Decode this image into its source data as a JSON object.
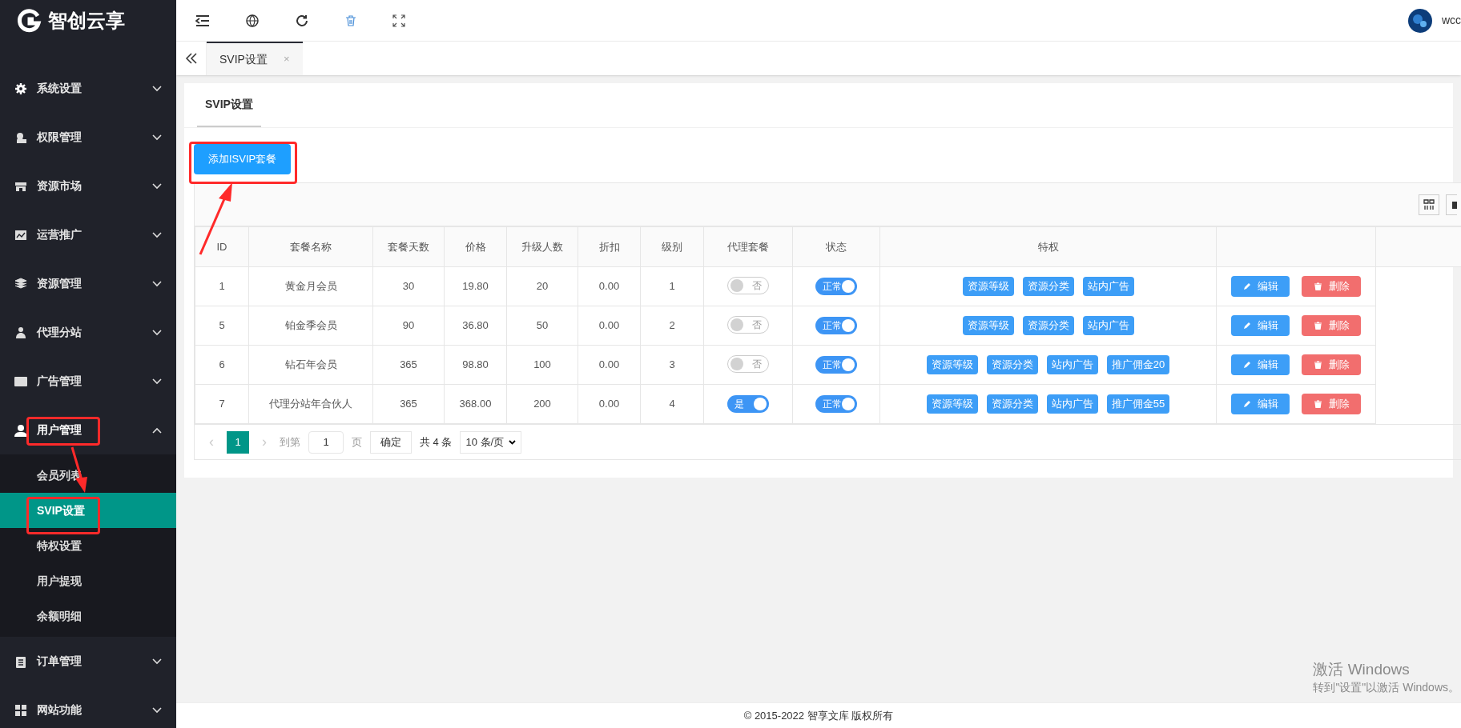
{
  "logo": {
    "text": "智创云享"
  },
  "sidebar": {
    "items": [
      {
        "label": "系统设置",
        "kind": "gear",
        "expanded": false
      },
      {
        "label": "权限管理",
        "kind": "lock",
        "expanded": false
      },
      {
        "label": "资源市场",
        "kind": "store",
        "expanded": false
      },
      {
        "label": "运营推广",
        "kind": "chart",
        "expanded": false
      },
      {
        "label": "资源管理",
        "kind": "layers",
        "expanded": false
      },
      {
        "label": "代理分站",
        "kind": "agent",
        "expanded": false
      },
      {
        "label": "广告管理",
        "kind": "ad",
        "expanded": false
      },
      {
        "label": "用户管理",
        "kind": "user",
        "expanded": true,
        "children": [
          {
            "label": "会员列表",
            "selected": false
          },
          {
            "label": "SVIP设置",
            "selected": true
          },
          {
            "label": "特权设置",
            "selected": false
          },
          {
            "label": "用户提现",
            "selected": false
          },
          {
            "label": "余额明细",
            "selected": false
          }
        ]
      },
      {
        "label": "订单管理",
        "kind": "clipboard",
        "expanded": false
      },
      {
        "label": "网站功能",
        "kind": "grid",
        "expanded": false
      }
    ]
  },
  "header": {
    "user": "wcc"
  },
  "tabs": [
    {
      "label": "SVIP设置",
      "selected": true,
      "close": "×"
    }
  ],
  "panel": {
    "title": "SVIP设置",
    "add_button": "添加ISVIP套餐"
  },
  "table": {
    "columns": [
      "ID",
      "套餐名称",
      "套餐天数",
      "价格",
      "升级人数",
      "折扣",
      "级别",
      "代理套餐",
      "状态",
      "特权"
    ],
    "rows": [
      {
        "id": "1",
        "name": "黄金月会员",
        "days": "30",
        "price": "19.80",
        "upgrade": "20",
        "discount": "0.00",
        "level": "1",
        "agent": {
          "label": "否",
          "on": false
        },
        "status": {
          "label": "正常",
          "on": true
        },
        "privileges": [
          "资源等级",
          "资源分类",
          "站内广告"
        ],
        "edit": "编辑",
        "delete": "删除"
      },
      {
        "id": "5",
        "name": "铂金季会员",
        "days": "90",
        "price": "36.80",
        "upgrade": "50",
        "discount": "0.00",
        "level": "2",
        "agent": {
          "label": "否",
          "on": false
        },
        "status": {
          "label": "正常",
          "on": true
        },
        "privileges": [
          "资源等级",
          "资源分类",
          "站内广告"
        ],
        "edit": "编辑",
        "delete": "删除"
      },
      {
        "id": "6",
        "name": "钻石年会员",
        "days": "365",
        "price": "98.80",
        "upgrade": "100",
        "discount": "0.00",
        "level": "3",
        "agent": {
          "label": "否",
          "on": false
        },
        "status": {
          "label": "正常",
          "on": true
        },
        "privileges": [
          "资源等级",
          "资源分类",
          "站内广告",
          "推广佣金20"
        ],
        "edit": "编辑",
        "delete": "删除"
      },
      {
        "id": "7",
        "name": "代理分站年合伙人",
        "days": "365",
        "price": "368.00",
        "upgrade": "200",
        "discount": "0.00",
        "level": "4",
        "agent": {
          "label": "是",
          "on": true
        },
        "status": {
          "label": "正常",
          "on": true
        },
        "privileges": [
          "资源等级",
          "资源分类",
          "站内广告",
          "推广佣金55"
        ],
        "edit": "编辑",
        "delete": "删除"
      }
    ]
  },
  "pagination": {
    "prev": "‹",
    "next": "›",
    "pages": [
      {
        "label": "1",
        "selected": true
      }
    ],
    "goto_label": "到第",
    "goto_value": "1",
    "page_unit": "页",
    "confirm": "确定",
    "total": "共 4 条",
    "page_size": "10 条/页"
  },
  "footer": "© 2015-2022 智享文库 版权所有",
  "activation": {
    "title": "激活 Windows",
    "subtitle": "转到\"设置\"以激活 Windows。"
  }
}
